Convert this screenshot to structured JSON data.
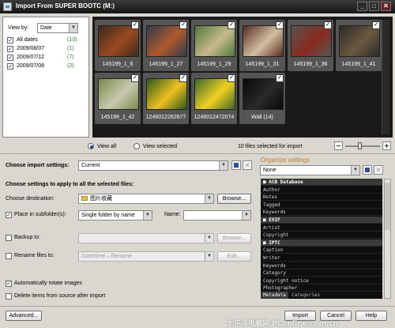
{
  "title": "Import From SUPER BOOTC (M:)",
  "title_buttons": [
    "_",
    "□",
    "✕"
  ],
  "filter": {
    "view_by_label": "View by:",
    "view_by_value": "Date",
    "items": [
      {
        "label": "All dates",
        "count": "(10)",
        "checked": true
      },
      {
        "label": "2009/08/07",
        "count": "(1)",
        "checked": true
      },
      {
        "label": "2009/07/12",
        "count": "(7)",
        "checked": true
      },
      {
        "label": "2009/07/08",
        "count": "(2)",
        "checked": true
      }
    ]
  },
  "thumbnails": [
    {
      "label": "145199_1_6",
      "colors": [
        "#3a2a1a",
        "#9a4a20"
      ]
    },
    {
      "label": "145199_1_27",
      "colors": [
        "#2d3b4e",
        "#b05a2a"
      ]
    },
    {
      "label": "145199_1_29",
      "colors": [
        "#4e7a3a",
        "#c9b98a"
      ]
    },
    {
      "label": "145199_1_31",
      "colors": [
        "#5a2a22",
        "#d0c0a0"
      ]
    },
    {
      "label": "145199_1_36",
      "colors": [
        "#555550",
        "#8a2a20"
      ]
    },
    {
      "label": "145199_1_41",
      "colors": [
        "#2a2a28",
        "#6a5a40"
      ]
    },
    {
      "label": "145199_1_42",
      "colors": [
        "#7a8a4a",
        "#c9c9b0"
      ]
    },
    {
      "label": "1246012262677",
      "colors": [
        "#2a5a1a",
        "#f0c020"
      ]
    },
    {
      "label": "1246012472074",
      "colors": [
        "#3a6a2a",
        "#f2d020"
      ]
    },
    {
      "label": "Wall (14)",
      "colors": [
        "#080808",
        "#2a2a2a"
      ]
    }
  ],
  "view_bar": {
    "view_all": "View all",
    "view_selected": "View selected",
    "count_text": "10 files selected for import"
  },
  "import_settings": {
    "label": "Choose import settings:",
    "value": "Current"
  },
  "apply_title": "Choose settings to apply to all the selected files:",
  "destination": {
    "label": "Choose destination:",
    "value": "图片收藏",
    "browse": "Browse..."
  },
  "subfolder": {
    "label": "Place in subfolder(s):",
    "value": "Single folder by name",
    "name_label": "Name:",
    "checked": true
  },
  "backup": {
    "label": "Backup to:",
    "browse": "Browse...",
    "checked": false
  },
  "rename": {
    "label": "Rename files to:",
    "value": "Date/time – filename",
    "edit": "Edit...",
    "checked": false
  },
  "auto_rotate": {
    "label": "Automatically rotate images",
    "checked": true
  },
  "delete_items": {
    "label": "Delete items from source after import",
    "checked": false
  },
  "organize": {
    "title": "Organize settings",
    "value": "None",
    "sections": [
      {
        "name": "ACB Database",
        "rows": [
          "Author",
          "Notes",
          "Tagged",
          "Keywords"
        ]
      },
      {
        "name": "EXIF",
        "rows": [
          "Artist",
          "Copyright"
        ]
      },
      {
        "name": "IPTC",
        "rows": [
          "Caption",
          "Writer",
          "Keywords",
          "Category",
          "Copyright notice",
          "Photographer"
        ]
      }
    ],
    "tabs": [
      "Metadata",
      "Categories"
    ]
  },
  "buttons": {
    "advanced": "Advanced...",
    "import": "Import",
    "cancel": "Cancel",
    "help": "Help"
  },
  "watermark": "太平洋电脑网 PConline.com.cn"
}
